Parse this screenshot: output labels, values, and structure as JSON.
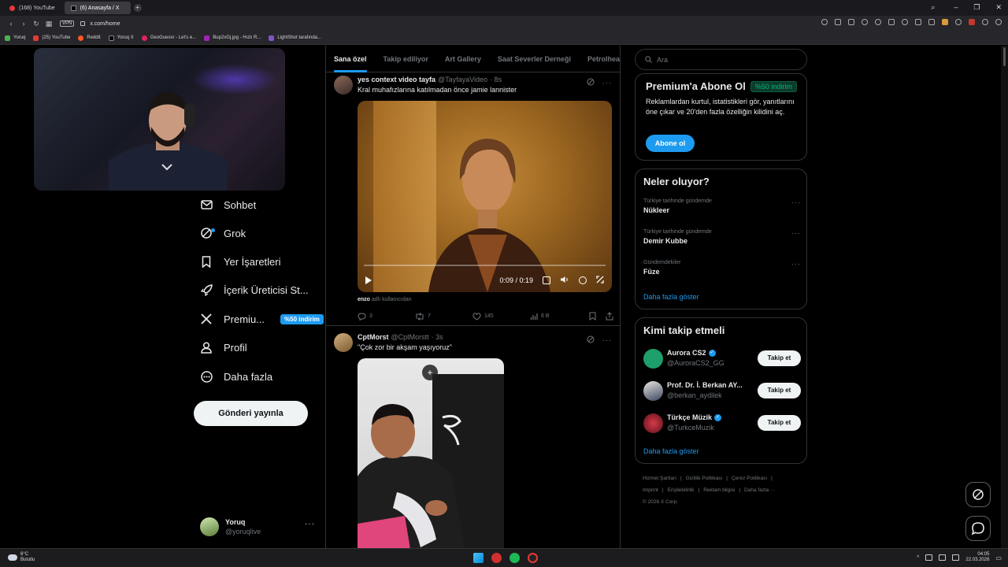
{
  "browser": {
    "tabs": [
      {
        "label": "(168) YouTube",
        "active": false
      },
      {
        "label": "(6) Anasayfa / X",
        "active": true
      }
    ],
    "new_tab": "+",
    "url": "x.com/home",
    "vpn_label": "VPN",
    "bookmarks": [
      "Yoruq",
      "(25) YouTube",
      "Reddit",
      "Yoruq X",
      "GeoGuessr - Let's e...",
      "Bup2xGj.jpg - Hızlı R...",
      "LightShot tarafında..."
    ]
  },
  "nav": {
    "items": [
      {
        "label": "Sohbet",
        "icon": "mail-icon"
      },
      {
        "label": "Grok",
        "icon": "grok-icon"
      },
      {
        "label": "Yer İşaretleri",
        "icon": "bookmark-icon"
      },
      {
        "label": "İçerik Üreticisi St...",
        "icon": "rocket-icon"
      },
      {
        "label": "Premiu...",
        "icon": "x-logo-icon",
        "badge": "%50 indirim"
      },
      {
        "label": "Profil",
        "icon": "person-icon"
      },
      {
        "label": "Daha fazla",
        "icon": "more-circle-icon"
      }
    ],
    "post_button": "Gönderi yayınla"
  },
  "account": {
    "name": "Yoruq",
    "handle": "@yoruqlive",
    "more": "···"
  },
  "timeline": {
    "tabs": [
      "Sana özel",
      "Takip ediliyor",
      "Art Gallery",
      "Saat Severler Derneği",
      "Petrolhea"
    ],
    "tweets": [
      {
        "name": "yes context video tayfa",
        "handle": "@TayfayaVideo",
        "time": "· 8s",
        "text": "Kral muhafızlarına katılmadan önce jamie lannister",
        "video_time": "0:09 / 0:19",
        "source_user": "enzo",
        "source_suffix": "adlı kullanıcıdan",
        "replies": "3",
        "reposts": "7",
        "likes": "145",
        "views": "6 B"
      },
      {
        "name": "CptMorst",
        "handle": "@CptMorstt",
        "time": "· 3s",
        "text": "\"Çok zor bir akşam yaşıyoruz\"",
        "media_badge": "+"
      }
    ]
  },
  "sidebar": {
    "search_placeholder": "Ara",
    "premium": {
      "title": "Premium'a Abone Ol",
      "badge": "%50 indirim",
      "description": "Reklamlardan kurtul, istatistikleri gör, yanıtlarını öne çıkar ve 20'den fazla özelliğin kilidini aç.",
      "button": "Abone ol"
    },
    "trends": {
      "title": "Neler oluyor?",
      "items": [
        {
          "context": "Türkiye tarihinde gündemde",
          "name": "Nükleer"
        },
        {
          "context": "Türkiye tarihinde gündemde",
          "name": "Demir Kubbe"
        },
        {
          "context": "Gündemdekiler",
          "name": "Füze"
        }
      ],
      "show_more": "Daha fazla göster"
    },
    "who_to_follow": {
      "title": "Kimi takip etmeli",
      "items": [
        {
          "name": "Aurora CS2",
          "handle": "@AuroraCS2_GG",
          "verified": true,
          "button": "Takip et"
        },
        {
          "name": "Prof. Dr. İ. Berkan AY...",
          "handle": "@berkan_aydilek",
          "verified": false,
          "button": "Takip et"
        },
        {
          "name": "Türkçe Müzik",
          "handle": "@TurkceMuzik",
          "verified": true,
          "button": "Takip et"
        }
      ],
      "show_more": "Daha fazla göster"
    },
    "footer": {
      "links": [
        "Hizmet Şartları",
        "Gizlilik Politikası",
        "Çerez Politikası",
        "Imprint",
        "Erişilebilirlik",
        "Reklam bilgisi",
        "Daha fazla ···"
      ],
      "copyright": "© 2026 X Corp."
    }
  },
  "taskbar": {
    "weather_temp": "6°C",
    "weather_desc": "Bulutlu",
    "time": "04:05",
    "date": "22.03.2026"
  },
  "colors": {
    "accent": "#1d9bf0",
    "background": "#000000",
    "border": "#2f3336",
    "muted": "#71767b",
    "green": "#00ba7c"
  }
}
